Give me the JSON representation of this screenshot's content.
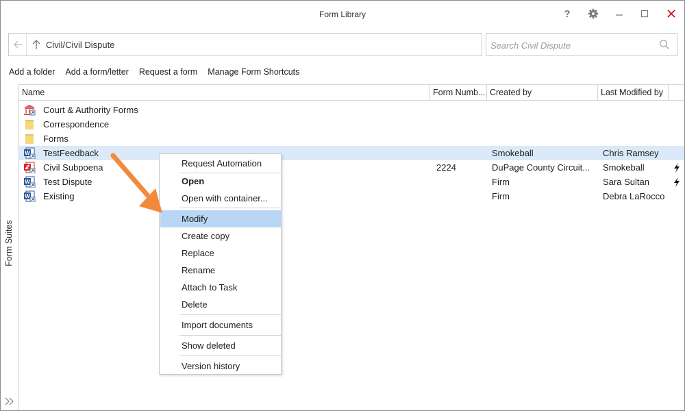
{
  "window": {
    "title": "Form Library"
  },
  "titlebar": {
    "help_glyph": "?",
    "minimize_glyph": "—"
  },
  "address": {
    "path": "Civil/Civil Dispute"
  },
  "search": {
    "placeholder": "Search Civil Dispute",
    "value": ""
  },
  "toolbar": {
    "add_folder": "Add a folder",
    "add_form": "Add a form/letter",
    "request_form": "Request a form",
    "manage_shortcuts": "Manage Form Shortcuts"
  },
  "side_panel": {
    "label": "Form Suites"
  },
  "columns": {
    "name": "Name",
    "form_number": "Form Numb...",
    "created_by": "Created by",
    "last_modified_by": "Last Modified by"
  },
  "rows": [
    {
      "name": "Court & Authority Forms",
      "icon": "court-building-icon",
      "form_number": "",
      "created_by": "",
      "last_modified_by": "",
      "selected": false
    },
    {
      "name": "Correspondence",
      "icon": "folder-icon",
      "form_number": "",
      "created_by": "",
      "last_modified_by": "",
      "selected": false
    },
    {
      "name": "Forms",
      "icon": "folder-icon",
      "form_number": "",
      "created_by": "",
      "last_modified_by": "",
      "selected": false
    },
    {
      "name": "TestFeedback",
      "icon": "word-doc-icon",
      "form_number": "",
      "created_by": "Smokeball",
      "last_modified_by": "Chris Ramsey",
      "selected": true
    },
    {
      "name": "Civil Subpoena",
      "icon": "pdf-doc-icon",
      "form_number": "2224",
      "created_by": "DuPage County Circuit...",
      "last_modified_by": "Smokeball",
      "selected": false,
      "automated": true
    },
    {
      "name": "Test Dispute",
      "icon": "word-doc-icon",
      "form_number": "",
      "created_by": "Firm",
      "last_modified_by": "Sara Sultan",
      "selected": false,
      "automated": true
    },
    {
      "name": "Existing",
      "icon": "word-doc-icon",
      "form_number": "",
      "created_by": "Firm",
      "last_modified_by": "Debra LaRocco",
      "selected": false
    }
  ],
  "context_menu": {
    "items": [
      {
        "label": "Request Automation"
      },
      {
        "label": "Open",
        "bold": true
      },
      {
        "label": "Open with container..."
      },
      {
        "label": "Modify",
        "highlighted": true
      },
      {
        "label": "Create copy"
      },
      {
        "label": "Replace"
      },
      {
        "label": "Rename"
      },
      {
        "label": "Attach to Task"
      },
      {
        "label": "Delete"
      },
      {
        "label": "Import documents"
      },
      {
        "label": "Show deleted"
      },
      {
        "label": "Version history"
      }
    ]
  },
  "colors": {
    "selected_row": "#dbe9f8",
    "menu_highlight": "#b9d7f5",
    "close_red": "#d0021b",
    "annotation_arrow": "#f28a3c",
    "folder_yellow": "#f5d77c",
    "word_blue": "#2b5797",
    "pdf_red": "#d12c2c"
  }
}
